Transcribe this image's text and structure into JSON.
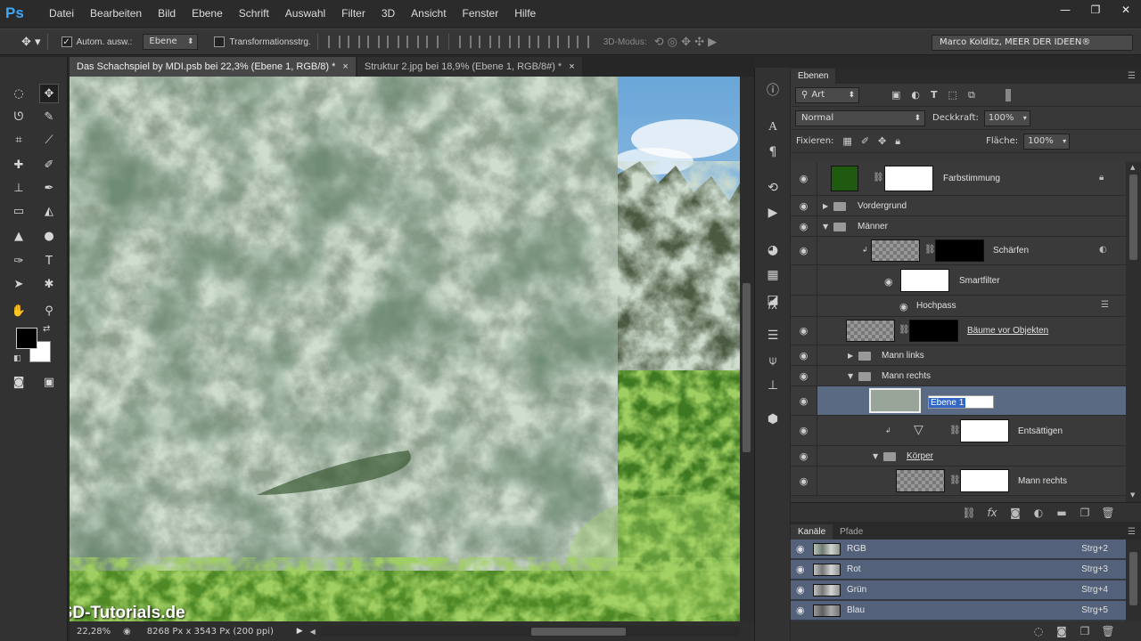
{
  "app": {
    "logo": "Ps"
  },
  "menu": [
    "Datei",
    "Bearbeiten",
    "Bild",
    "Ebene",
    "Schrift",
    "Auswahl",
    "Filter",
    "3D",
    "Ansicht",
    "Fenster",
    "Hilfe"
  ],
  "window_controls": {
    "minimize": "—",
    "restore": "❐",
    "close": "✕"
  },
  "options": {
    "auto_select_label": "Autom. ausw.:",
    "auto_select_value": "Ebene",
    "transform_label": "Transformationsstrg.",
    "mode3d_label": "3D-Modus:",
    "workspace": "Marco Kolditz, MEER DER IDEEN®"
  },
  "doc_tabs": [
    {
      "label": "Das Schachspiel by MDI.psb bei 22,3% (Ebene 1, RGB/8) *",
      "close": "×"
    },
    {
      "label": "Struktur 2.jpg bei 18,9% (Ebene 1, RGB/8#) *",
      "close": "×"
    }
  ],
  "watermark": "PSD-Tutorials.de",
  "status": {
    "zoom": "22,28%",
    "docinfo": "8268 Px x 3543 Px (200 ppi)"
  },
  "layers_panel": {
    "tab": "Ebenen",
    "filter_kind": "Art",
    "blend_mode": "Normal",
    "opacity_label": "Deckkraft:",
    "opacity_value": "100%",
    "lock_label": "Fixieren:",
    "fill_label": "Fläche:",
    "fill_value": "100%",
    "layers": {
      "farbstimmung": "Farbstimmung",
      "vordergrund": "Vordergrund",
      "maenner": "Männer",
      "schaerfen": "Schärfen",
      "smartfilter": "Smartfilter",
      "hochpass": "Hochpass",
      "baeume": "Bäume vor Objekten",
      "mann_links": "Mann links",
      "mann_rechts_group": "Mann rechts",
      "ebene1": "Ebene 1",
      "entsaettigen": "Entsättigen",
      "koerper": "Körper",
      "mann_rechts_layer": "Mann rechts"
    }
  },
  "channels_panel": {
    "tabs": [
      "Kanäle",
      "Pfade"
    ],
    "channels": [
      {
        "name": "RGB",
        "shortcut": "Strg+2"
      },
      {
        "name": "Rot",
        "shortcut": "Strg+3"
      },
      {
        "name": "Grün",
        "shortcut": "Strg+4"
      },
      {
        "name": "Blau",
        "shortcut": "Strg+5"
      }
    ]
  },
  "colors": {
    "accent": "#3ea6f5",
    "selection": "#5a6a82",
    "channel_row": "#53627a",
    "adjustment_swatch": "#1f5a10"
  }
}
